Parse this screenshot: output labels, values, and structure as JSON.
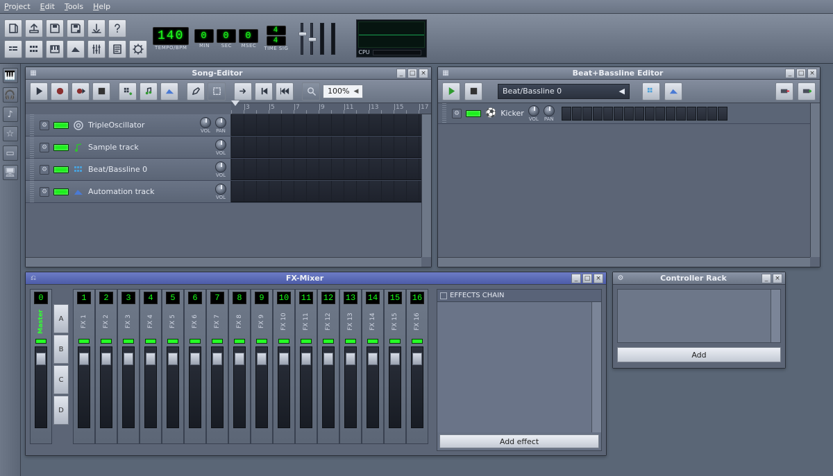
{
  "menubar": {
    "project": "Project",
    "edit": "Edit",
    "tools": "Tools",
    "help": "Help"
  },
  "transport": {
    "tempo": "140",
    "tempo_label": "TEMPO/BPM",
    "min": "0",
    "min_label": "MIN",
    "sec": "0",
    "sec_label": "SEC",
    "msec": "0",
    "msec_label": "MSEC",
    "tsig_num": "4",
    "tsig_den": "4",
    "tsig_label": "TIME SIG",
    "cpu_label": "CPU"
  },
  "song_editor": {
    "title": "Song-Editor",
    "zoom": "100%",
    "ruler": [
      "3",
      "5",
      "7",
      "9",
      "11",
      "13",
      "15",
      "17"
    ],
    "knob_vol": "VOL",
    "knob_pan": "PAN",
    "tracks": [
      {
        "name": "TripleOscillator",
        "icon": "osc",
        "show_pan": true
      },
      {
        "name": "Sample track",
        "icon": "note",
        "show_pan": false
      },
      {
        "name": "Beat/Bassline 0",
        "icon": "grid",
        "show_pan": false
      },
      {
        "name": "Automation track",
        "icon": "automation",
        "show_pan": false
      }
    ]
  },
  "bb_editor": {
    "title": "Beat+Bassline Editor",
    "selected": "Beat/Bassline 0",
    "knob_vol": "VOL",
    "knob_pan": "PAN",
    "track_name": "Kicker",
    "cells": 16
  },
  "fx_mixer": {
    "title": "FX-Mixer",
    "master": {
      "num": "0",
      "label": "Master"
    },
    "sends": [
      "A",
      "B",
      "C",
      "D"
    ],
    "channels": [
      {
        "num": "1",
        "label": "FX 1"
      },
      {
        "num": "2",
        "label": "FX 2"
      },
      {
        "num": "3",
        "label": "FX 3"
      },
      {
        "num": "4",
        "label": "FX 4"
      },
      {
        "num": "5",
        "label": "FX 5"
      },
      {
        "num": "6",
        "label": "FX 6"
      },
      {
        "num": "7",
        "label": "FX 7"
      },
      {
        "num": "8",
        "label": "FX 8"
      },
      {
        "num": "9",
        "label": "FX 9"
      },
      {
        "num": "10",
        "label": "FX 10"
      },
      {
        "num": "11",
        "label": "FX 11"
      },
      {
        "num": "12",
        "label": "FX 12"
      },
      {
        "num": "13",
        "label": "FX 13"
      },
      {
        "num": "14",
        "label": "FX 14"
      },
      {
        "num": "15",
        "label": "FX 15"
      },
      {
        "num": "16",
        "label": "FX 16"
      }
    ],
    "effects_chain_label": "EFFECTS CHAIN",
    "add_effect": "Add effect"
  },
  "controller_rack": {
    "title": "Controller Rack",
    "add": "Add"
  }
}
